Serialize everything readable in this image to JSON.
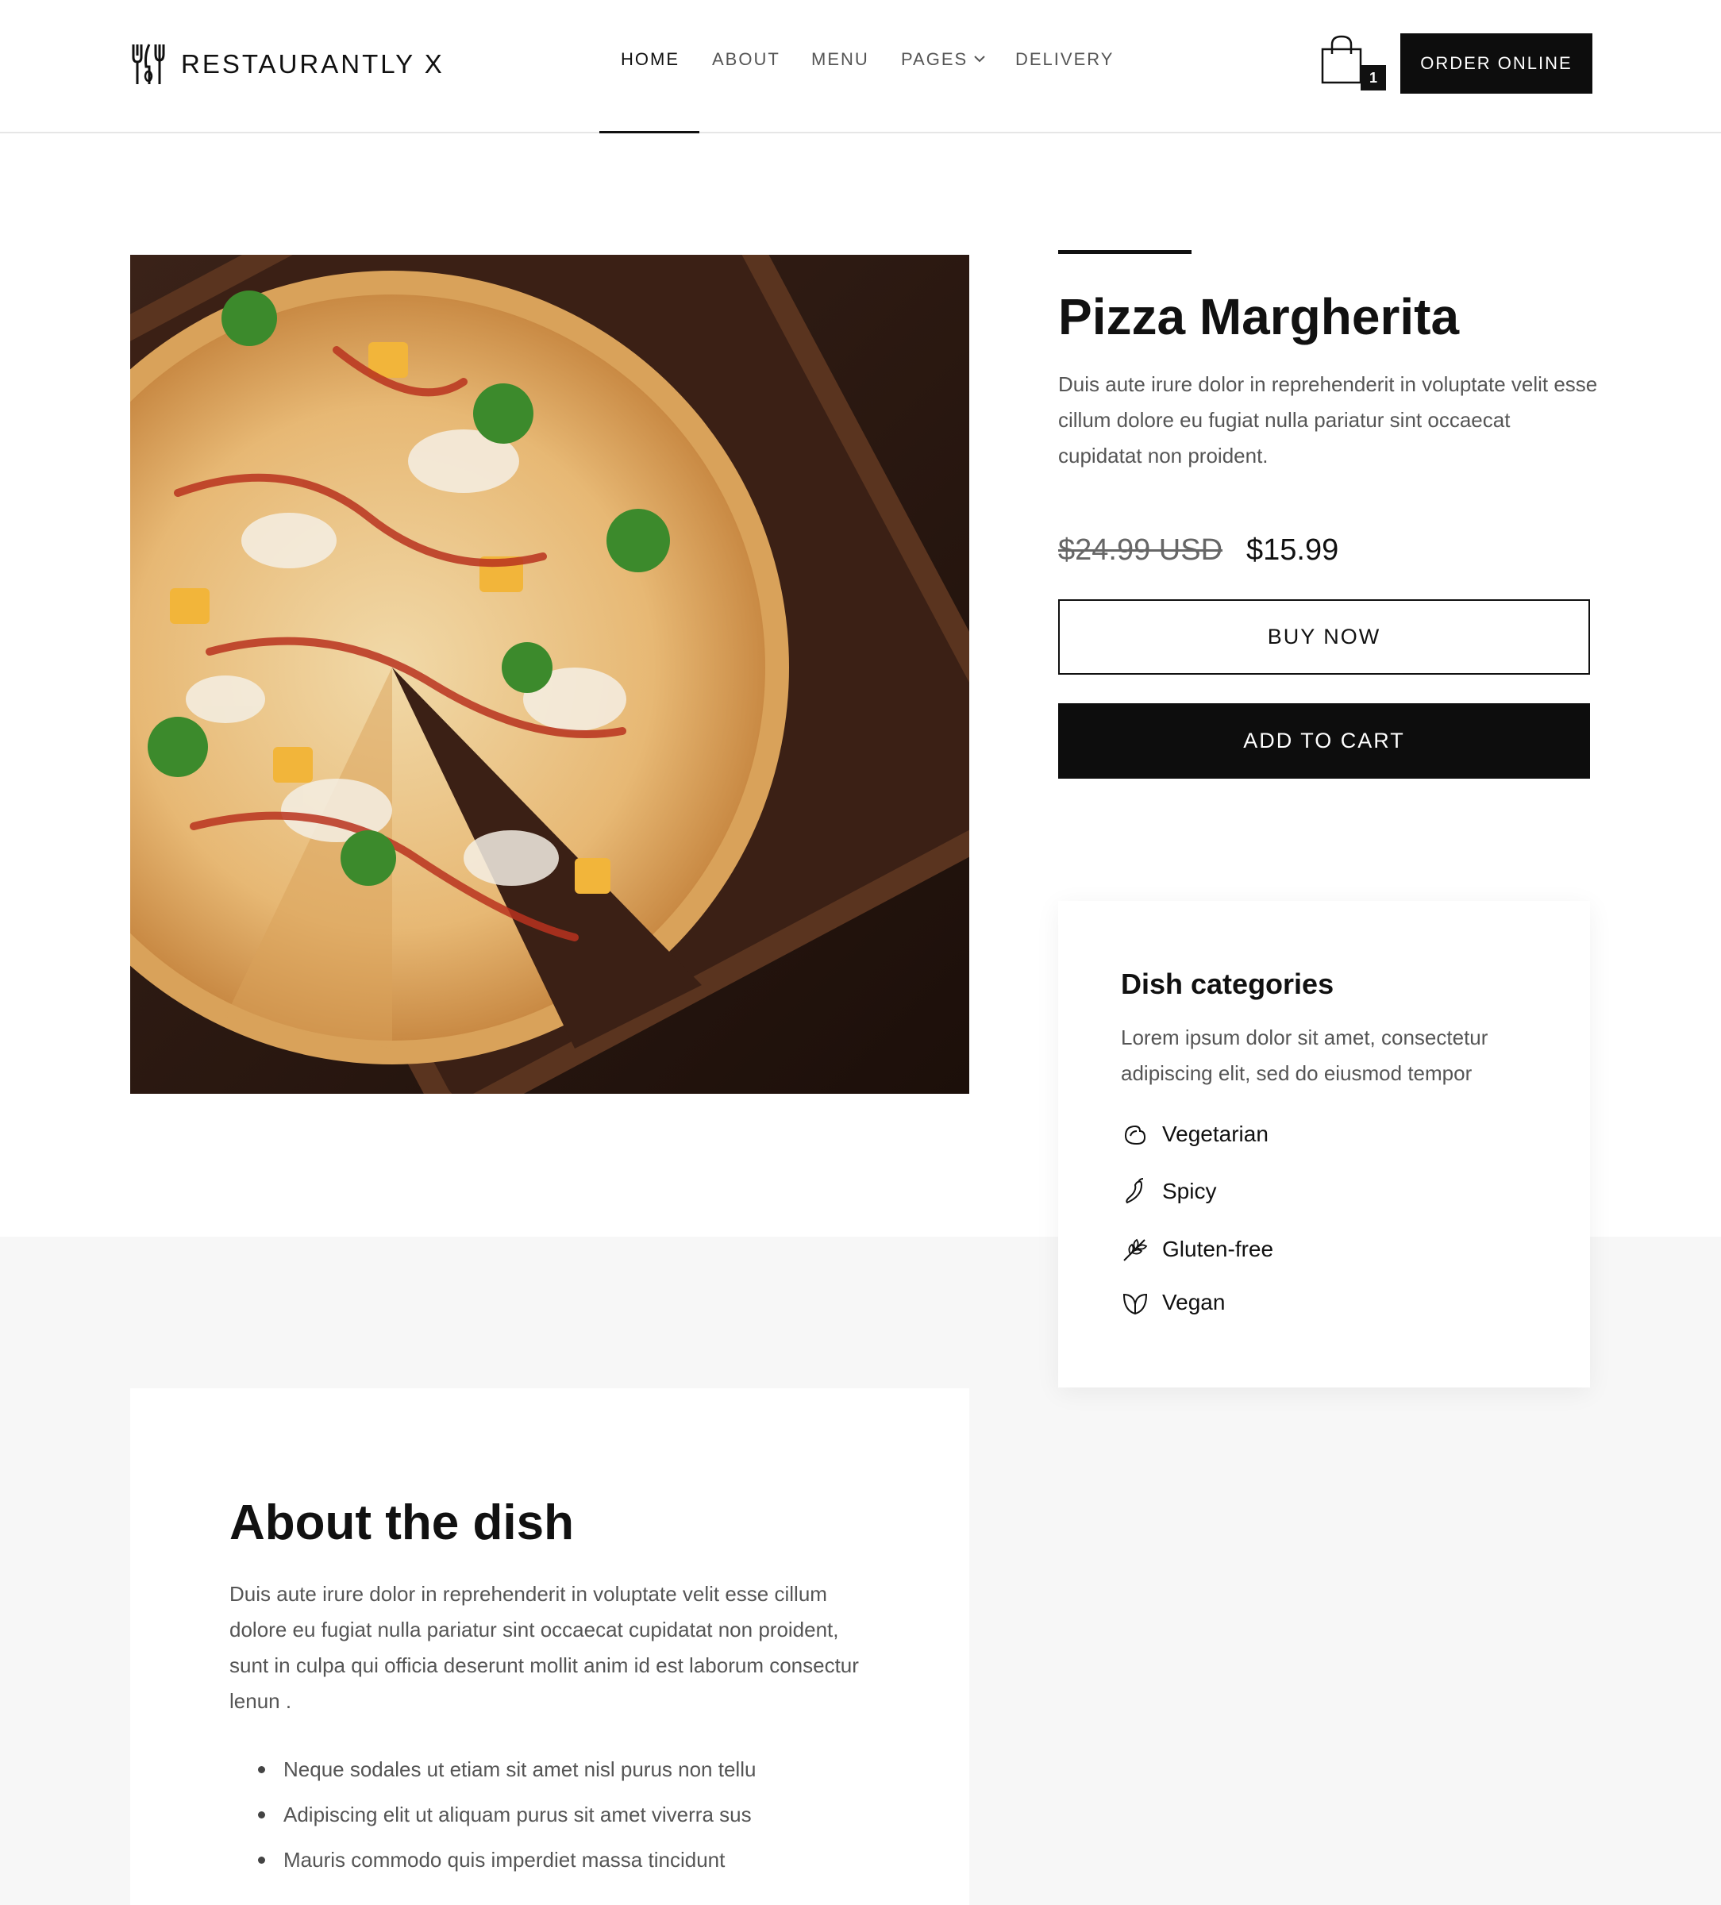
{
  "header": {
    "brand": "RESTAURANTLY X",
    "nav": [
      {
        "label": "HOME",
        "active": true
      },
      {
        "label": "ABOUT",
        "active": false
      },
      {
        "label": "MENU",
        "active": false
      },
      {
        "label": "PAGES",
        "active": false,
        "has_dropdown": true
      },
      {
        "label": "DELIVERY",
        "active": false
      }
    ],
    "cart_count": "1",
    "order_button": "ORDER ONLINE"
  },
  "product": {
    "title": "Pizza Margherita",
    "description": "Duis aute irure dolor in reprehenderit in voluptate velit esse cillum dolore eu fugiat nulla pariatur sint occaecat cupidatat non proident.",
    "price_old": "$24.99 USD",
    "price_new": "$15.99",
    "buy_now": "BUY NOW",
    "add_to_cart": "ADD TO CART"
  },
  "categories": {
    "title": "Dish categories",
    "description": "Lorem ipsum dolor sit amet, consectetur adipiscing elit, sed do eiusmod tempor",
    "items": [
      {
        "label": "Vegetarian",
        "icon": "vegetarian-icon"
      },
      {
        "label": "Spicy",
        "icon": "chili-pepper-icon"
      },
      {
        "label": "Gluten-free",
        "icon": "wheat-icon"
      },
      {
        "label": "Vegan",
        "icon": "leaf-icon"
      }
    ]
  },
  "about": {
    "title": "About the dish",
    "description": "Duis aute irure dolor in reprehenderit in voluptate velit esse cillum dolore eu fugiat nulla pariatur sint occaecat cupidatat non proident, sunt in culpa qui officia deserunt mollit anim id est laborum consectur lenun .",
    "bullets": [
      "Neque sodales ut etiam sit amet nisl purus non tellu",
      "Adipiscing elit ut aliquam purus sit amet viverra sus",
      "Mauris commodo quis imperdiet massa tincidunt"
    ]
  },
  "colors": {
    "accent": "#0d0d0d",
    "muted_text": "#555555",
    "band_bg": "#f7f7f7"
  }
}
